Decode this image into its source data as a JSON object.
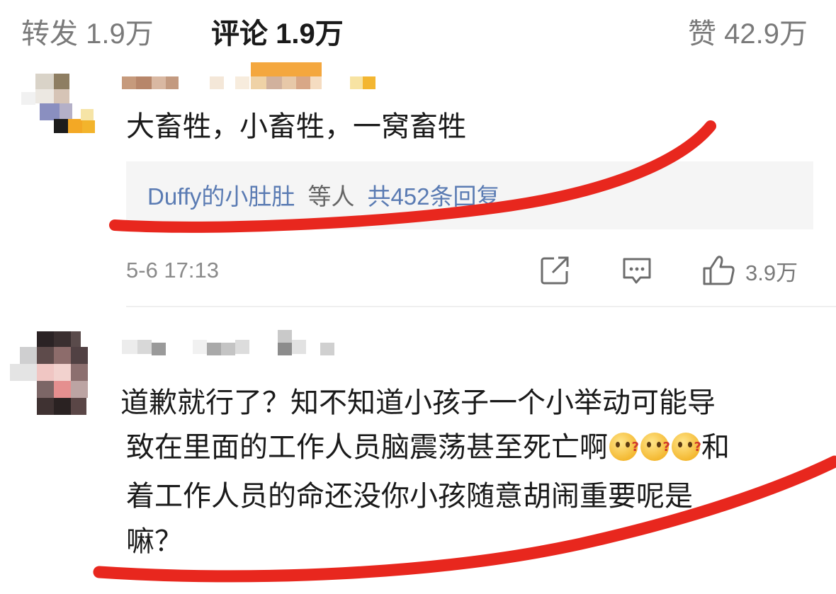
{
  "tabs": {
    "repost": "转发 1.9万",
    "comments": "评论 1.9万",
    "likes": "赞 42.9万"
  },
  "comments": [
    {
      "text": "大畜牲，小畜牲，一窝畜牲",
      "replies": {
        "user": "Duffy的小肚肚",
        "suffix": "等人",
        "count": "共452条回复"
      },
      "time": "5-6 17:13",
      "like_count": "3.9万"
    },
    {
      "lines": [
        "道歉就行了？知不知道小孩子一个小举动可能导",
        "致在里面的工作人员脑震荡甚至死亡啊",
        "和",
        "着工作人员的命还没你小孩随意胡闹重要呢是",
        "嘛？"
      ]
    }
  ],
  "colors": {
    "annotation_red": "#e8271e",
    "link_blue": "#5a7bb3"
  },
  "icons": [
    "share-icon",
    "comment-icon",
    "thumbs-up-icon",
    "thinking-emoji"
  ]
}
